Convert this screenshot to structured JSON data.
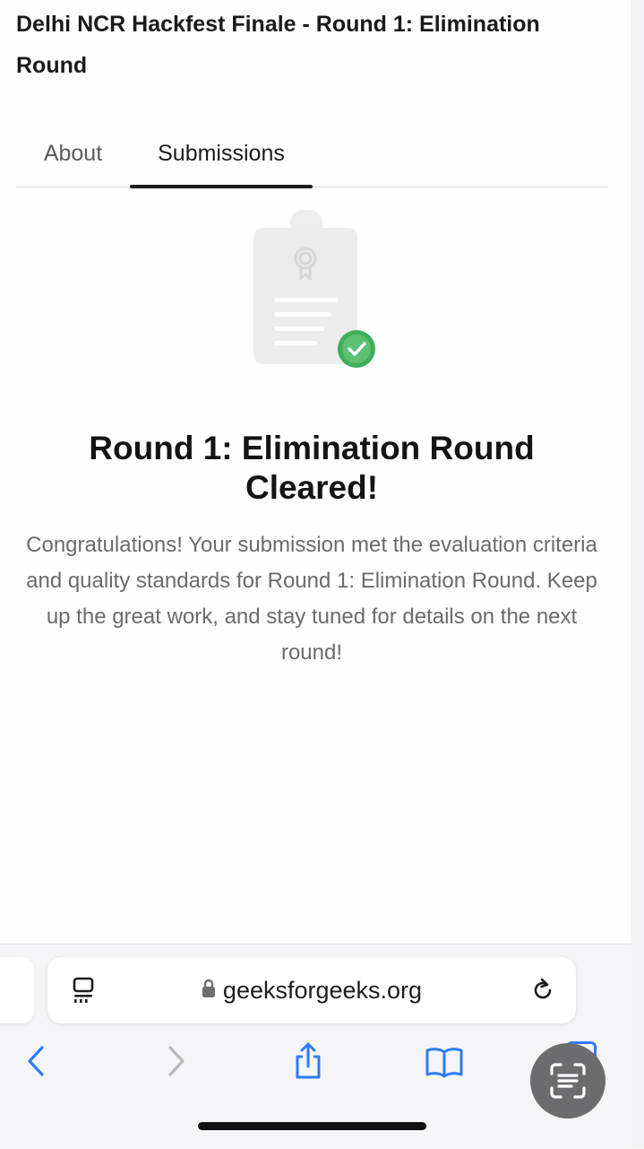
{
  "event": {
    "title": "Delhi NCR Hackfest Finale - Round 1: Elimination Round"
  },
  "tabs": [
    {
      "label": "About",
      "active": false
    },
    {
      "label": "Submissions",
      "active": true
    }
  ],
  "result": {
    "heading": "Round 1: Elimination Round Cleared!",
    "message": "Congratulations! Your submission met the evaluation criteria and quality standards for Round 1: Elimination Round. Keep up the great work, and stay tuned for details on the next round!",
    "illustration": "certificate-clipboard-with-check",
    "status_color": "#3fae5a"
  },
  "browser": {
    "url": "geeksforgeeks.org",
    "secure": true,
    "toolbar": [
      "back",
      "forward",
      "share",
      "bookmarks",
      "text-scan"
    ],
    "accent_color": "#2f7bf5"
  }
}
